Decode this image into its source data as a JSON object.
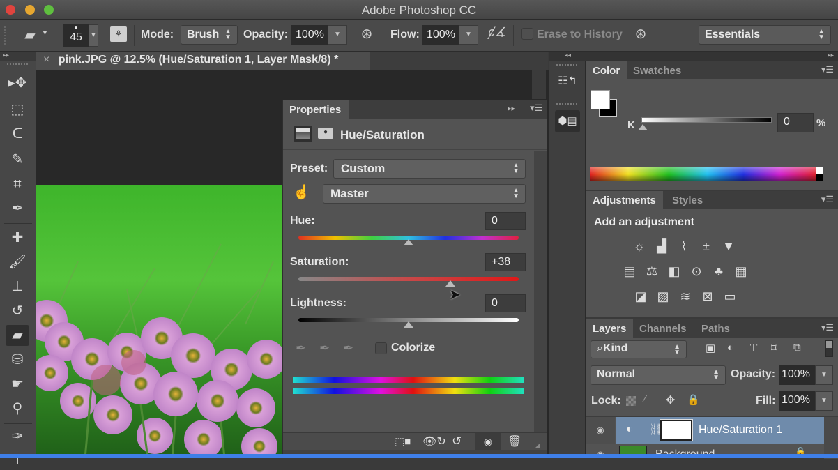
{
  "window": {
    "title": "Adobe Photoshop CC",
    "traffic_lights": {
      "close": "#e0443e",
      "minimize": "#e6a730",
      "zoom": "#5fbf3f"
    }
  },
  "options_bar": {
    "tool_icon": "eraser-icon",
    "brush_size": "45",
    "mode_label": "Mode:",
    "mode_value": "Brush",
    "opacity_label": "Opacity:",
    "opacity_value": "100%",
    "flow_label": "Flow:",
    "flow_value": "100%",
    "erase_to_history_label": "Erase to History",
    "erase_to_history_checked": false,
    "workspace": "Essentials"
  },
  "document_tab": {
    "close_glyph": "×",
    "title": "pink.JPG @ 12.5% (Hue/Saturation 1, Layer Mask/8) *"
  },
  "toolbar": {
    "tools": [
      {
        "name": "move-tool",
        "glyph": "▸✥"
      },
      {
        "name": "marquee-tool",
        "glyph": "⬚"
      },
      {
        "name": "lasso-tool",
        "glyph": "ᑕ"
      },
      {
        "name": "quick-selection-tool",
        "glyph": "✎"
      },
      {
        "name": "crop-tool",
        "glyph": "⌗"
      },
      {
        "name": "eyedropper-tool",
        "glyph": "✒"
      },
      {
        "name": "healing-brush-tool",
        "glyph": "✚"
      },
      {
        "name": "brush-tool",
        "glyph": "🖌"
      },
      {
        "name": "clone-stamp-tool",
        "glyph": "⊥"
      },
      {
        "name": "history-brush-tool",
        "glyph": "↺"
      },
      {
        "name": "eraser-tool",
        "glyph": "▰",
        "active": true
      },
      {
        "name": "paint-bucket-tool",
        "glyph": "⛁"
      },
      {
        "name": "smudge-tool",
        "glyph": "☛"
      },
      {
        "name": "dodge-tool",
        "glyph": "⚲"
      },
      {
        "name": "pen-tool",
        "glyph": "✑"
      },
      {
        "name": "type-tool",
        "glyph": "T"
      }
    ]
  },
  "properties": {
    "tab_label": "Properties",
    "header_title": "Hue/Saturation",
    "preset_label": "Preset:",
    "preset_value": "Custom",
    "channel_value": "Master",
    "hue_label": "Hue:",
    "hue_value": "0",
    "hue_fraction": 0.5,
    "saturation_label": "Saturation:",
    "saturation_value": "+38",
    "saturation_fraction": 0.69,
    "lightness_label": "Lightness:",
    "lightness_value": "0",
    "lightness_fraction": 0.5,
    "colorize_label": "Colorize",
    "colorize_checked": false
  },
  "color_panel": {
    "tabs": [
      "Color",
      "Swatches"
    ],
    "active_tab": "Color",
    "foreground": "#ffffff",
    "background": "#000000",
    "k_label": "K",
    "k_value": "0",
    "k_unit": "%"
  },
  "adjustments_panel": {
    "tabs": [
      "Adjustments",
      "Styles"
    ],
    "active_tab": "Adjustments",
    "heading": "Add an adjustment",
    "rows": [
      [
        "brightness-contrast",
        "levels",
        "curves",
        "exposure",
        "vibrance"
      ],
      [
        "hue-saturation",
        "color-balance",
        "black-white",
        "photo-filter",
        "channel-mixer",
        "color-lookup"
      ],
      [
        "invert",
        "posterize",
        "threshold",
        "selective-color",
        "gradient-map"
      ]
    ]
  },
  "layers_panel": {
    "tabs": [
      "Layers",
      "Channels",
      "Paths"
    ],
    "active_tab": "Layers",
    "filter_kind": "Kind",
    "blend_mode": "Normal",
    "opacity_label": "Opacity:",
    "opacity_value": "100%",
    "lock_label": "Lock:",
    "fill_label": "Fill:",
    "fill_value": "100%",
    "layers": [
      {
        "name": "Hue/Saturation 1",
        "visible": true,
        "selected": true
      },
      {
        "name": "Background",
        "visible": true,
        "selected": false,
        "locked": true
      }
    ]
  }
}
